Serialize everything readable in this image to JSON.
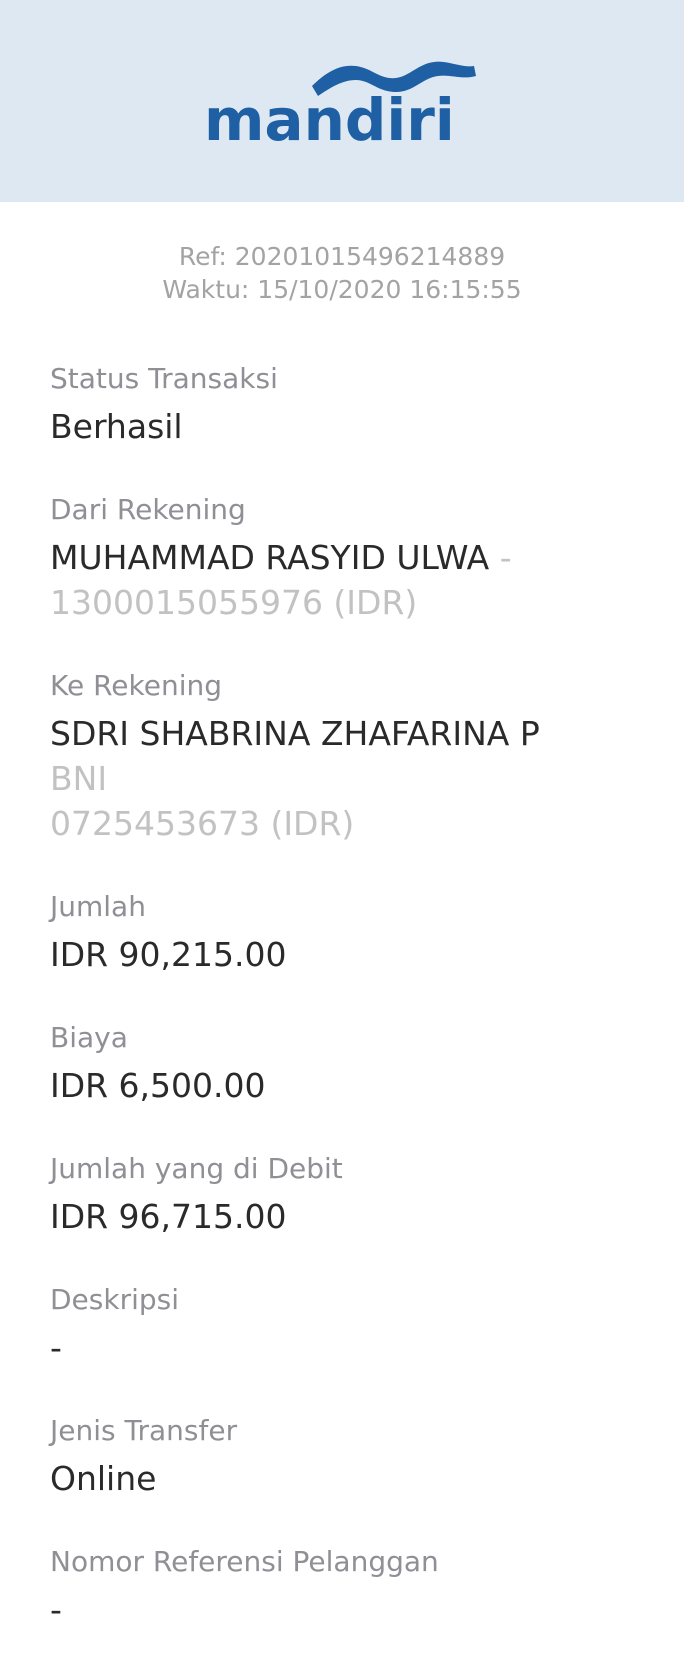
{
  "brand": {
    "name": "mandiri",
    "logo_text_color": "#1f5fa3",
    "header_bg": "#dde8f3"
  },
  "meta": {
    "ref": "Ref: 20201015496214889",
    "time": "Waktu: 15/10/2020 16:15:55"
  },
  "fields": {
    "status": {
      "label": "Status Transaksi",
      "value": "Berhasil"
    },
    "from": {
      "label": "Dari Rekening",
      "name": "MUHAMMAD RASYID ULWA",
      "separator": " -",
      "account": "1300015055976 (IDR)"
    },
    "to": {
      "label": "Ke Rekening",
      "name": "SDRI SHABRINA ZHAFARINA P",
      "bank": "BNI",
      "account": "0725453673 (IDR)"
    },
    "amount": {
      "label": "Jumlah",
      "value": "IDR 90,215.00"
    },
    "fee": {
      "label": "Biaya",
      "value": "IDR 6,500.00"
    },
    "debited": {
      "label": "Jumlah yang di Debit",
      "value": "IDR 96,715.00"
    },
    "description": {
      "label": "Deskripsi",
      "value": "-"
    },
    "transfer_type": {
      "label": "Jenis Transfer",
      "value": "Online"
    },
    "customer_ref": {
      "label": "Nomor Referensi Pelanggan",
      "value": "-"
    }
  }
}
